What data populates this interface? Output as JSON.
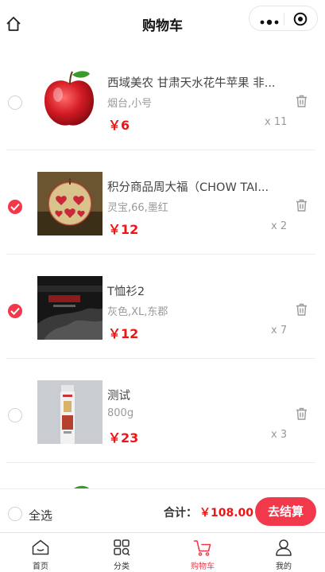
{
  "header": {
    "title": "购物车"
  },
  "cart": {
    "items": [
      {
        "name": "西域美农 甘肃天水花牛苹果 非...",
        "spec": "烟台,小号",
        "price": "￥6",
        "qty": "x 11",
        "checked": false,
        "image": "red-apple"
      },
      {
        "name": "积分商品周大福（CHOW TAI...",
        "spec": "灵宝,66,墨红",
        "price": "￥12",
        "qty": "x 2",
        "checked": true,
        "image": "heart-apple"
      },
      {
        "name": "T恤衫2",
        "spec": "灰色,XL,东郡",
        "price": "￥12",
        "qty": "x 7",
        "checked": true,
        "image": "dark-photo"
      },
      {
        "name": "测试",
        "spec": "800g",
        "price": "￥23",
        "qty": "x 3",
        "checked": false,
        "image": "bottle"
      }
    ]
  },
  "footer": {
    "select_all": "全选",
    "total_label": "合计：",
    "total_value": "￥108.00",
    "checkout": "去结算"
  },
  "tabbar": {
    "tabs": [
      {
        "label": "首页",
        "icon": "home-icon"
      },
      {
        "label": "分类",
        "icon": "category-icon"
      },
      {
        "label": "购物车",
        "icon": "cart-icon",
        "active": true
      },
      {
        "label": "我的",
        "icon": "user-icon"
      }
    ]
  },
  "colors": {
    "accent": "#f2384b",
    "price": "#f01414"
  }
}
